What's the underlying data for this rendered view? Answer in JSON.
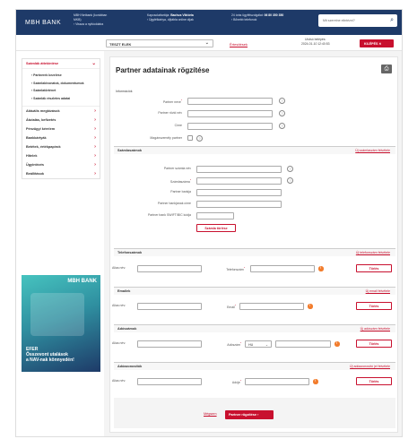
{
  "colors": {
    "brand": "#1e3a68",
    "accent": "#c8102e",
    "warn": "#f27c2c"
  },
  "header": {
    "logo": "MBH",
    "logo_sub": "BANK",
    "col1": [
      "MBH Netbank (korábban",
      "MKB)",
      "› Vissza a nyitóoldalra"
    ],
    "col2_title": "Kapcsolattartója:",
    "col2_name": "Bachus Viktória",
    "col2_link": "› Ügyfélkártya, díjtábla online díjak",
    "col3_title": "24 órás ügyfélszolgálat:",
    "col3_phone": "06 80 350 350",
    "col3_link": "› Bővebb telefonok",
    "search_placeholder": "Mit szeretne elintézni?",
    "search_icon": "search-icon"
  },
  "subbar": {
    "user": "TESZT ELEK",
    "info_link": "Értesítések",
    "last_login_label": "Utolsó belépés:",
    "last_login_value": "2024-01-10 12:40:53",
    "logout": "KILÉPÉS"
  },
  "sidebar": {
    "head": "Számlák áttekintése",
    "subitems": [
      "Partnerek kezelése",
      "Számlakivonatok, dokumentumok",
      "Számlatörténet",
      "Számlák részletes adatai"
    ],
    "items": [
      "Aktuális megbízások",
      "Átutalás, befizetés",
      "Pénzügyi kérelem",
      "Bankkártyák",
      "Betétek, értékpapírok",
      "Hitelek",
      "Ügyintézés",
      "Beállítások"
    ]
  },
  "promo": {
    "logo": "MBH BANK",
    "line1": "EFER",
    "line2": "Összevont utalások",
    "line3": "a NAV-nak könnyedén!"
  },
  "page": {
    "title": "Partner adatainak rögzítése",
    "printer_icon": "printer-icon"
  },
  "info": {
    "caption": "Információk",
    "partner_name": "Partner neve",
    "partner_short": "Partner rövid név",
    "address": "Címe",
    "private": "Magánszemély partner"
  },
  "accounts": {
    "title": "Számlaszámok",
    "add_link": "Új számlaszám felvétele",
    "acct_name": "Partner számla név",
    "acct_num": "Számlaszáma",
    "bank": "Partner bankja",
    "bank_addr": "Partner bankjának címe",
    "swift": "Partner bank SWIFT/BIC kódja",
    "del_btn": "Számla törlése"
  },
  "phone": {
    "title": "Telefonszámok",
    "add_link": "Új telefonszám felvétele",
    "alias": "Alias név:",
    "field": "Telefonszám",
    "del": "Törlés"
  },
  "email": {
    "title": "Emailek",
    "add_link": "Új email felvétele",
    "alias": "Alias név:",
    "field": "Email",
    "del": "Törlés"
  },
  "tax": {
    "title": "Adószámok",
    "add_link": "Új adószám felvétele",
    "alias": "Alias név:",
    "field": "Adószám",
    "country": "HU",
    "del": "Törlés"
  },
  "taxid": {
    "title": "Adóazonosítók",
    "add_link": "Új adóazonosító jel felvétele",
    "alias": "Alias név:",
    "field": "Adóje",
    "del": "Törlés"
  },
  "footer": {
    "back": "Mégsem",
    "save": "Partner rögzítése ›"
  }
}
